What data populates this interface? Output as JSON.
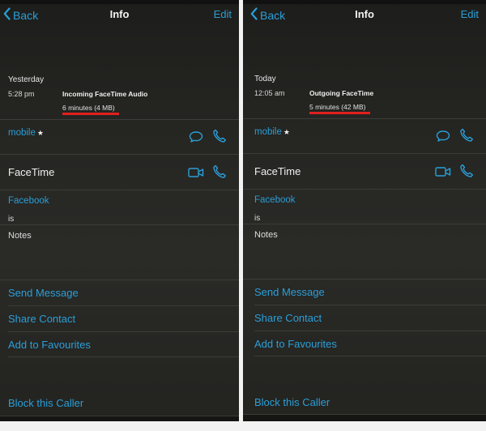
{
  "accent_color": "#2a9fd8",
  "highlight_color": "#e0201d",
  "panels": [
    {
      "nav": {
        "back_label": "Back",
        "title": "Info",
        "edit_label": "Edit"
      },
      "call": {
        "date": "Yesterday",
        "time": "5:28 pm",
        "type": "Incoming FaceTime Audio",
        "duration": "6 minutes (4 MB)"
      },
      "mobile_label": "mobile",
      "star_glyph": "★",
      "facetime_label": "FaceTime",
      "facebook_label": "Facebook",
      "facebook_value": "is",
      "notes_label": "Notes",
      "actions": {
        "send_message": "Send Message",
        "share_contact": "Share Contact",
        "add_favourites": "Add to Favourites",
        "block_caller": "Block this Caller"
      },
      "icons": [
        "chevron-left-icon",
        "message-icon",
        "phone-icon",
        "video-icon",
        "phone-icon"
      ]
    },
    {
      "nav": {
        "back_label": "Back",
        "title": "Info",
        "edit_label": "Edit"
      },
      "call": {
        "date": "Today",
        "time": "12:05 am",
        "type": "Outgoing FaceTime",
        "duration": "5 minutes (42 MB)"
      },
      "mobile_label": "mobile",
      "star_glyph": "★",
      "facetime_label": "FaceTime",
      "facebook_label": "Facebook",
      "facebook_value": "is",
      "notes_label": "Notes",
      "actions": {
        "send_message": "Send Message",
        "share_contact": "Share Contact",
        "add_favourites": "Add to Favourites",
        "block_caller": "Block this Caller"
      },
      "icons": [
        "chevron-left-icon",
        "message-icon",
        "phone-icon",
        "video-icon",
        "phone-icon"
      ]
    }
  ]
}
